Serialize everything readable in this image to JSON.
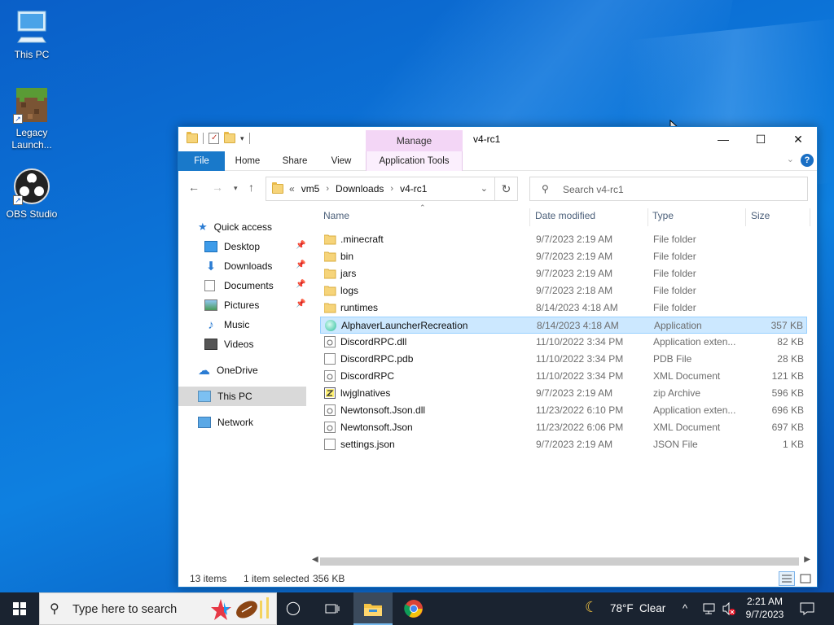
{
  "desktop": {
    "icons": [
      {
        "label": "This PC"
      },
      {
        "label": "Legacy Launch..."
      },
      {
        "label": "OBS Studio"
      }
    ]
  },
  "window": {
    "title": "v4-rc1",
    "context_tab_group": "Manage",
    "ribbon_tabs": [
      "File",
      "Home",
      "Share",
      "View",
      "Application Tools"
    ],
    "address": {
      "overflow": "«",
      "crumbs": [
        "vm5",
        "Downloads",
        "v4-rc1"
      ]
    },
    "search": {
      "placeholder": "Search v4-rc1"
    },
    "nav": {
      "quick_access": "Quick access",
      "items": [
        {
          "label": "Desktop",
          "pinned": true
        },
        {
          "label": "Downloads",
          "pinned": true
        },
        {
          "label": "Documents",
          "pinned": true
        },
        {
          "label": "Pictures",
          "pinned": true
        },
        {
          "label": "Music",
          "pinned": false
        },
        {
          "label": "Videos",
          "pinned": false
        }
      ],
      "onedrive": "OneDrive",
      "thispc": "This PC",
      "network": "Network"
    },
    "columns": [
      "Name",
      "Date modified",
      "Type",
      "Size"
    ],
    "files": [
      {
        "name": ".minecraft",
        "date": "9/7/2023 2:19 AM",
        "type": "File folder",
        "size": "",
        "icon": "folder-icon"
      },
      {
        "name": "bin",
        "date": "9/7/2023 2:19 AM",
        "type": "File folder",
        "size": "",
        "icon": "folder-icon"
      },
      {
        "name": "jars",
        "date": "9/7/2023 2:19 AM",
        "type": "File folder",
        "size": "",
        "icon": "folder-icon"
      },
      {
        "name": "logs",
        "date": "9/7/2023 2:18 AM",
        "type": "File folder",
        "size": "",
        "icon": "folder-icon"
      },
      {
        "name": "runtimes",
        "date": "8/14/2023 4:18 AM",
        "type": "File folder",
        "size": "",
        "icon": "folder-icon"
      },
      {
        "name": "AlphaverLauncherRecreation",
        "date": "8/14/2023 4:18 AM",
        "type": "Application",
        "size": "357 KB",
        "icon": "app-icon",
        "selected": true
      },
      {
        "name": "DiscordRPC.dll",
        "date": "11/10/2022 3:34 PM",
        "type": "Application exten...",
        "size": "82 KB",
        "icon": "dll-icon"
      },
      {
        "name": "DiscordRPC.pdb",
        "date": "11/10/2022 3:34 PM",
        "type": "PDB File",
        "size": "28 KB",
        "icon": "document-icon"
      },
      {
        "name": "DiscordRPC",
        "date": "11/10/2022 3:34 PM",
        "type": "XML Document",
        "size": "121 KB",
        "icon": "xml-icon"
      },
      {
        "name": "lwjglnatives",
        "date": "9/7/2023 2:19 AM",
        "type": "zip Archive",
        "size": "596 KB",
        "icon": "zip-icon"
      },
      {
        "name": "Newtonsoft.Json.dll",
        "date": "11/23/2022 6:10 PM",
        "type": "Application exten...",
        "size": "696 KB",
        "icon": "dll-icon"
      },
      {
        "name": "Newtonsoft.Json",
        "date": "11/23/2022 6:06 PM",
        "type": "XML Document",
        "size": "697 KB",
        "icon": "xml-icon"
      },
      {
        "name": "settings.json",
        "date": "9/7/2023 2:19 AM",
        "type": "JSON File",
        "size": "1 KB",
        "icon": "document-icon"
      }
    ],
    "status": {
      "count": "13 items",
      "selected": "1 item selected",
      "selected_size": "356 KB"
    }
  },
  "taskbar": {
    "search_placeholder": "Type here to search",
    "weather": {
      "temp": "78°F",
      "condition": "Clear"
    },
    "clock": {
      "time": "2:21 AM",
      "date": "9/7/2023"
    }
  }
}
